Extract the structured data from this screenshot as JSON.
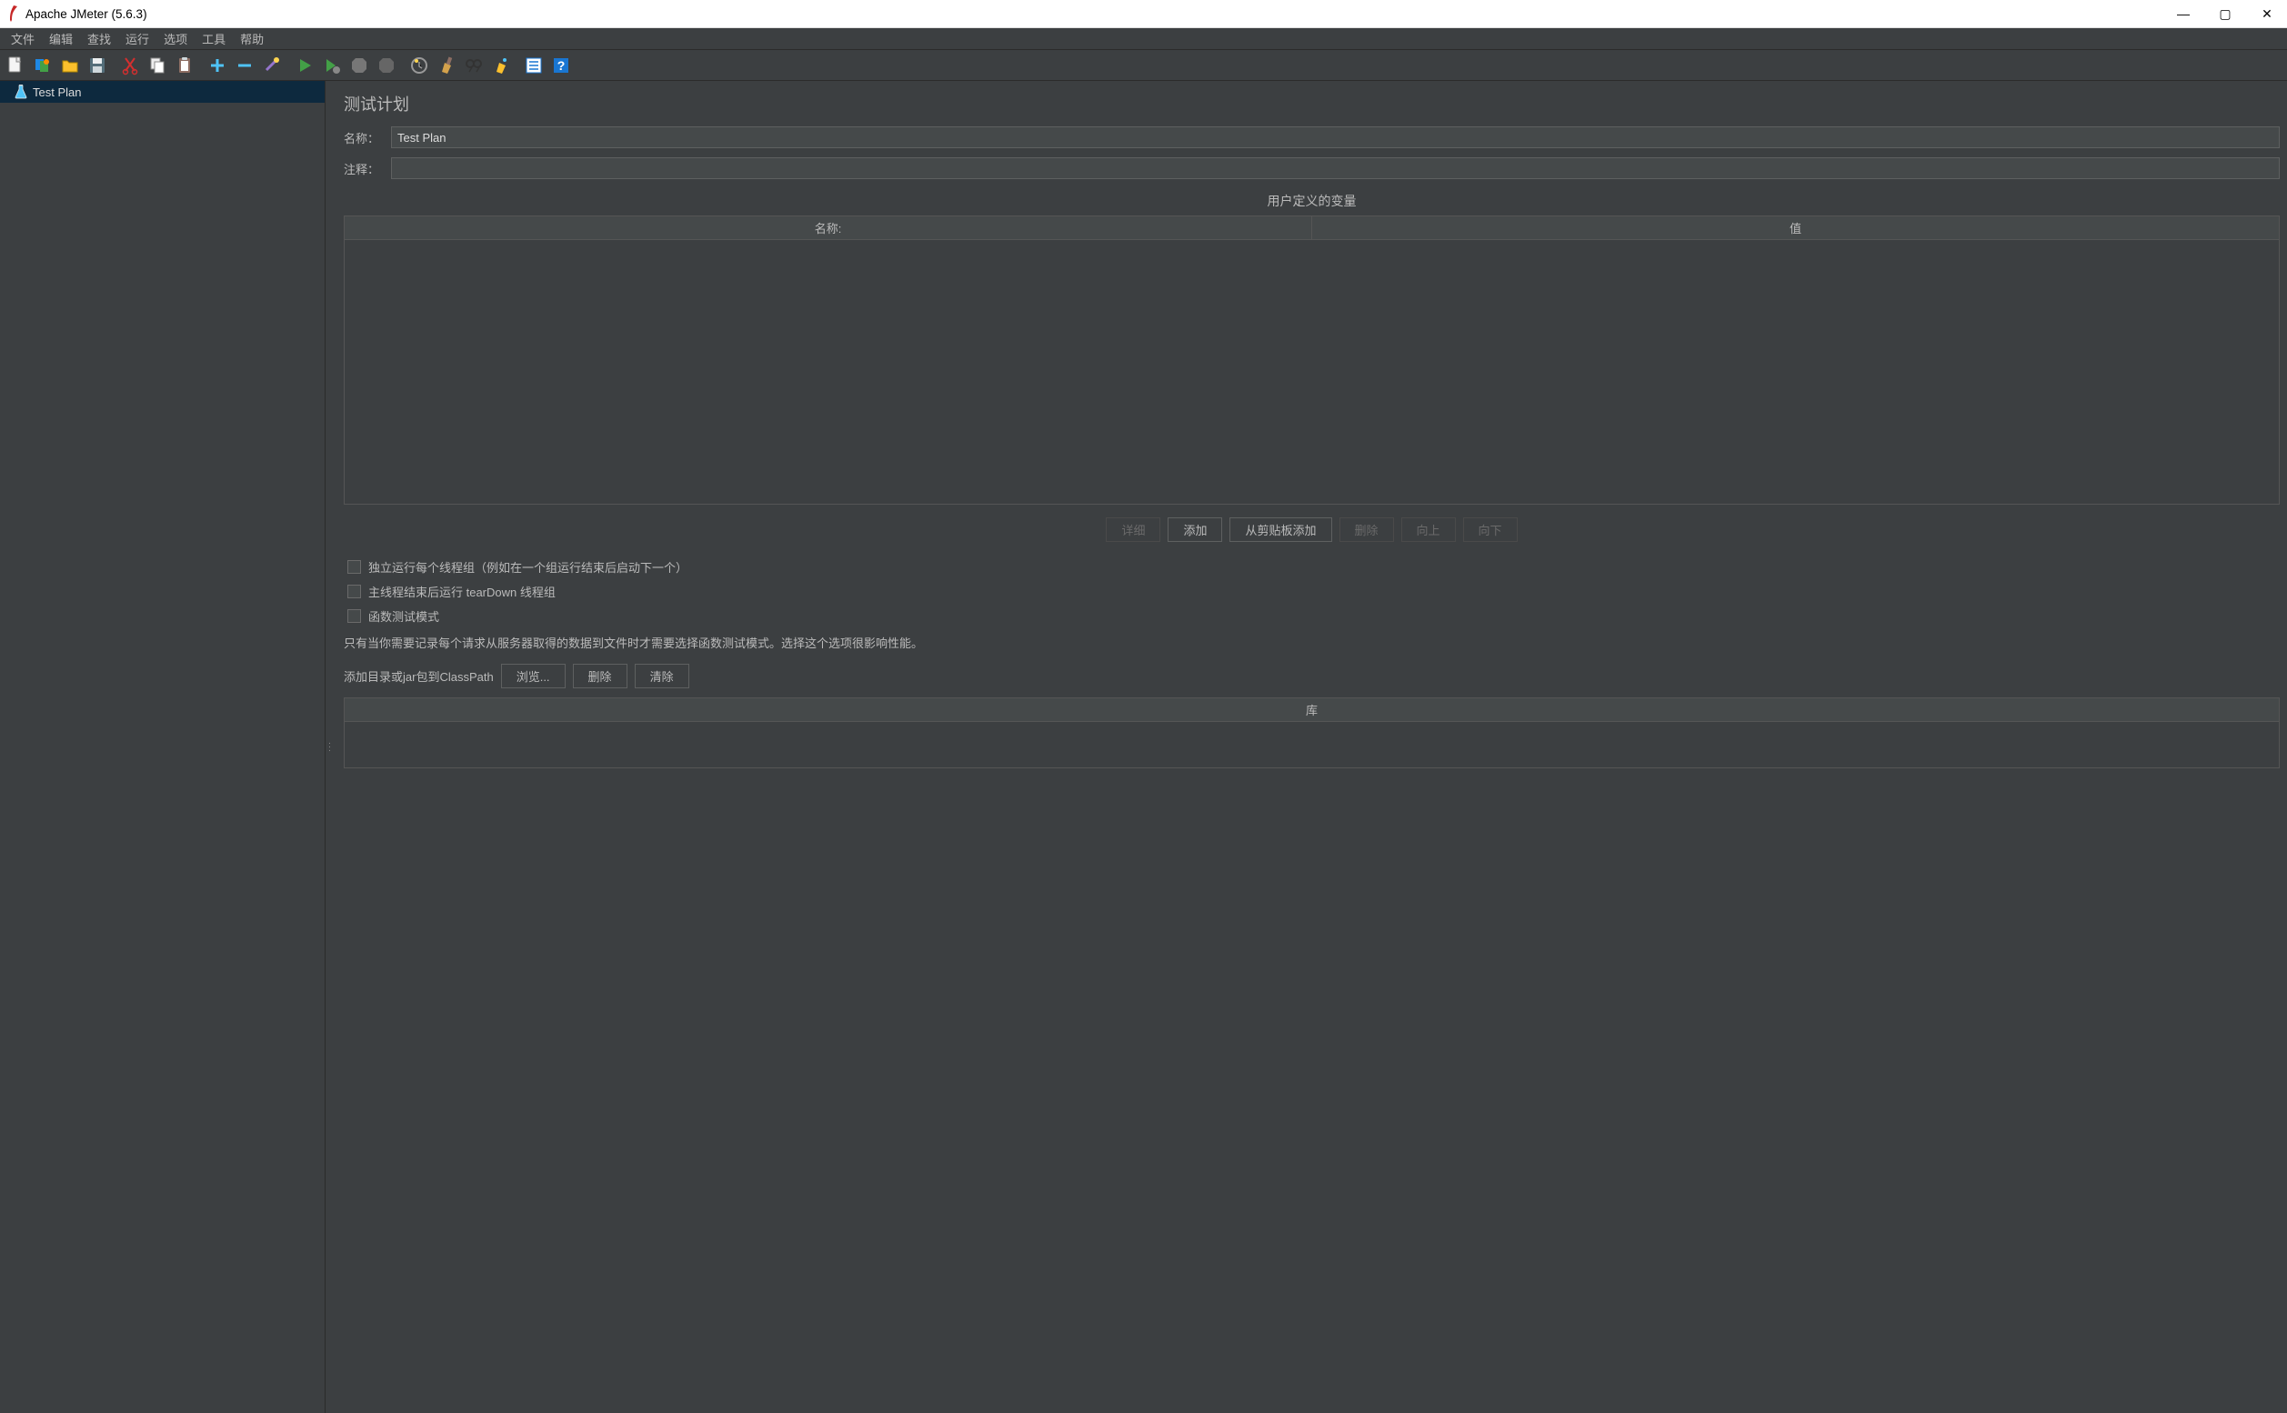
{
  "window": {
    "title": "Apache JMeter (5.6.3)"
  },
  "menu": {
    "file": "文件",
    "edit": "编辑",
    "search": "查找",
    "run": "运行",
    "options": "选项",
    "tools": "工具",
    "help": "帮助"
  },
  "tree": {
    "root": "Test Plan"
  },
  "panel": {
    "title": "测试计划",
    "name_label": "名称：",
    "name_value": "Test Plan",
    "comment_label": "注释：",
    "comment_value": "",
    "vars_title": "用户定义的变量",
    "col_name": "名称:",
    "col_value": "值",
    "buttons": {
      "detail": "详细",
      "add": "添加",
      "clipboard": "从剪贴板添加",
      "delete": "删除",
      "up": "向上",
      "down": "向下"
    },
    "checkboxes": {
      "run_serial": "独立运行每个线程组（例如在一个组运行结束后启动下一个）",
      "teardown": "主线程结束后运行 tearDown 线程组",
      "functional": "函数测试模式"
    },
    "functional_hint": "只有当你需要记录每个请求从服务器取得的数据到文件时才需要选择函数测试模式。选择这个选项很影响性能。",
    "classpath_label": "添加目录或jar包到ClassPath",
    "classpath_buttons": {
      "browse": "浏览...",
      "delete": "删除",
      "clear": "清除"
    },
    "lib_header": "库"
  }
}
